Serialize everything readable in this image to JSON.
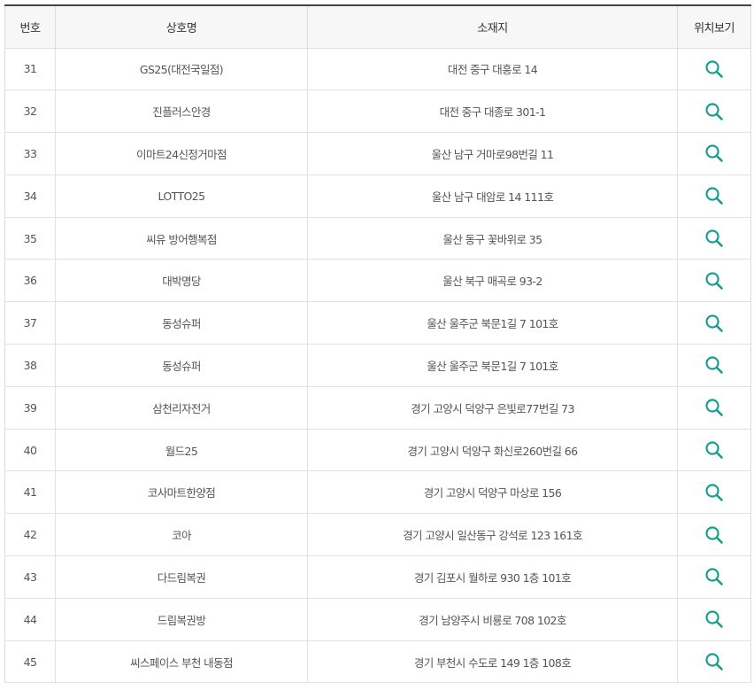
{
  "table": {
    "headers": {
      "no": "번호",
      "name": "상호명",
      "address": "소재지",
      "map": "위치보기"
    },
    "rows": [
      {
        "no": "31",
        "name": "GS25(대전국일점)",
        "address": "대전 중구 대흥로 14"
      },
      {
        "no": "32",
        "name": "진플러스안경",
        "address": "대전 중구 대종로 301-1"
      },
      {
        "no": "33",
        "name": "이마트24신정거마점",
        "address": "울산 남구 거마로98번길 11"
      },
      {
        "no": "34",
        "name": "LOTTO25",
        "address": "울산 남구 대암로 14 111호"
      },
      {
        "no": "35",
        "name": "씨유 방어행복점",
        "address": "울산 동구 꽃바위로 35"
      },
      {
        "no": "36",
        "name": "대박명당",
        "address": "울산 북구 매곡로 93-2"
      },
      {
        "no": "37",
        "name": "동성슈퍼",
        "address": "울산 울주군 북문1길 7 101호"
      },
      {
        "no": "38",
        "name": "동성슈퍼",
        "address": "울산 울주군 북문1길 7 101호"
      },
      {
        "no": "39",
        "name": "삼천리자전거",
        "address": "경기 고양시 덕양구 은빛로77번길 73"
      },
      {
        "no": "40",
        "name": "월드25",
        "address": "경기 고양시 덕양구 화신로260번길 66"
      },
      {
        "no": "41",
        "name": "코사마트한양점",
        "address": "경기 고양시 덕양구 마상로 156"
      },
      {
        "no": "42",
        "name": "코아",
        "address": "경기 고양시 일산동구 강석로 123 161호"
      },
      {
        "no": "43",
        "name": "다드림복권",
        "address": "경기 김포시 월하로 930 1층 101호"
      },
      {
        "no": "44",
        "name": "드림복권방",
        "address": "경기 남양주시 비룡로 708 102호"
      },
      {
        "no": "45",
        "name": "씨스페이스 부천 내동점",
        "address": "경기 부천시 수도로 149 1층 108호"
      }
    ],
    "map_icon": "search-icon",
    "icon_color": "#1a9e8f"
  }
}
